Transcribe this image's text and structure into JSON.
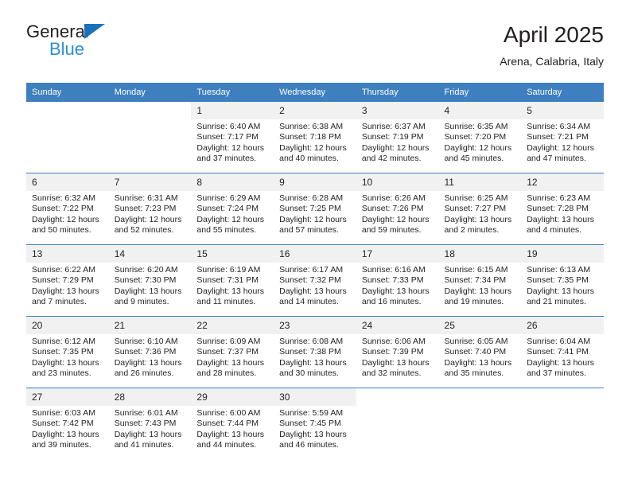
{
  "brand": {
    "line1": "General",
    "line2": "Blue",
    "triangle_color": "#1a72ba",
    "blue_text_color": "#2b8fd4"
  },
  "header": {
    "title": "April 2025",
    "subtitle": "Arena, Calabria, Italy"
  },
  "theme": {
    "header_blue": "#3d7fbf",
    "daynum_gray": "#f1f1f1",
    "text": "#231f20"
  },
  "weekday_headers": [
    "Sunday",
    "Monday",
    "Tuesday",
    "Wednesday",
    "Thursday",
    "Friday",
    "Saturday"
  ],
  "weeks": [
    [
      {
        "day": "",
        "sunrise": "",
        "sunset": "",
        "daylight": ""
      },
      {
        "day": "",
        "sunrise": "",
        "sunset": "",
        "daylight": ""
      },
      {
        "day": "1",
        "sunrise": "Sunrise: 6:40 AM",
        "sunset": "Sunset: 7:17 PM",
        "daylight": "Daylight: 12 hours and 37 minutes."
      },
      {
        "day": "2",
        "sunrise": "Sunrise: 6:38 AM",
        "sunset": "Sunset: 7:18 PM",
        "daylight": "Daylight: 12 hours and 40 minutes."
      },
      {
        "day": "3",
        "sunrise": "Sunrise: 6:37 AM",
        "sunset": "Sunset: 7:19 PM",
        "daylight": "Daylight: 12 hours and 42 minutes."
      },
      {
        "day": "4",
        "sunrise": "Sunrise: 6:35 AM",
        "sunset": "Sunset: 7:20 PM",
        "daylight": "Daylight: 12 hours and 45 minutes."
      },
      {
        "day": "5",
        "sunrise": "Sunrise: 6:34 AM",
        "sunset": "Sunset: 7:21 PM",
        "daylight": "Daylight: 12 hours and 47 minutes."
      }
    ],
    [
      {
        "day": "6",
        "sunrise": "Sunrise: 6:32 AM",
        "sunset": "Sunset: 7:22 PM",
        "daylight": "Daylight: 12 hours and 50 minutes."
      },
      {
        "day": "7",
        "sunrise": "Sunrise: 6:31 AM",
        "sunset": "Sunset: 7:23 PM",
        "daylight": "Daylight: 12 hours and 52 minutes."
      },
      {
        "day": "8",
        "sunrise": "Sunrise: 6:29 AM",
        "sunset": "Sunset: 7:24 PM",
        "daylight": "Daylight: 12 hours and 55 minutes."
      },
      {
        "day": "9",
        "sunrise": "Sunrise: 6:28 AM",
        "sunset": "Sunset: 7:25 PM",
        "daylight": "Daylight: 12 hours and 57 minutes."
      },
      {
        "day": "10",
        "sunrise": "Sunrise: 6:26 AM",
        "sunset": "Sunset: 7:26 PM",
        "daylight": "Daylight: 12 hours and 59 minutes."
      },
      {
        "day": "11",
        "sunrise": "Sunrise: 6:25 AM",
        "sunset": "Sunset: 7:27 PM",
        "daylight": "Daylight: 13 hours and 2 minutes."
      },
      {
        "day": "12",
        "sunrise": "Sunrise: 6:23 AM",
        "sunset": "Sunset: 7:28 PM",
        "daylight": "Daylight: 13 hours and 4 minutes."
      }
    ],
    [
      {
        "day": "13",
        "sunrise": "Sunrise: 6:22 AM",
        "sunset": "Sunset: 7:29 PM",
        "daylight": "Daylight: 13 hours and 7 minutes."
      },
      {
        "day": "14",
        "sunrise": "Sunrise: 6:20 AM",
        "sunset": "Sunset: 7:30 PM",
        "daylight": "Daylight: 13 hours and 9 minutes."
      },
      {
        "day": "15",
        "sunrise": "Sunrise: 6:19 AM",
        "sunset": "Sunset: 7:31 PM",
        "daylight": "Daylight: 13 hours and 11 minutes."
      },
      {
        "day": "16",
        "sunrise": "Sunrise: 6:17 AM",
        "sunset": "Sunset: 7:32 PM",
        "daylight": "Daylight: 13 hours and 14 minutes."
      },
      {
        "day": "17",
        "sunrise": "Sunrise: 6:16 AM",
        "sunset": "Sunset: 7:33 PM",
        "daylight": "Daylight: 13 hours and 16 minutes."
      },
      {
        "day": "18",
        "sunrise": "Sunrise: 6:15 AM",
        "sunset": "Sunset: 7:34 PM",
        "daylight": "Daylight: 13 hours and 19 minutes."
      },
      {
        "day": "19",
        "sunrise": "Sunrise: 6:13 AM",
        "sunset": "Sunset: 7:35 PM",
        "daylight": "Daylight: 13 hours and 21 minutes."
      }
    ],
    [
      {
        "day": "20",
        "sunrise": "Sunrise: 6:12 AM",
        "sunset": "Sunset: 7:35 PM",
        "daylight": "Daylight: 13 hours and 23 minutes."
      },
      {
        "day": "21",
        "sunrise": "Sunrise: 6:10 AM",
        "sunset": "Sunset: 7:36 PM",
        "daylight": "Daylight: 13 hours and 26 minutes."
      },
      {
        "day": "22",
        "sunrise": "Sunrise: 6:09 AM",
        "sunset": "Sunset: 7:37 PM",
        "daylight": "Daylight: 13 hours and 28 minutes."
      },
      {
        "day": "23",
        "sunrise": "Sunrise: 6:08 AM",
        "sunset": "Sunset: 7:38 PM",
        "daylight": "Daylight: 13 hours and 30 minutes."
      },
      {
        "day": "24",
        "sunrise": "Sunrise: 6:06 AM",
        "sunset": "Sunset: 7:39 PM",
        "daylight": "Daylight: 13 hours and 32 minutes."
      },
      {
        "day": "25",
        "sunrise": "Sunrise: 6:05 AM",
        "sunset": "Sunset: 7:40 PM",
        "daylight": "Daylight: 13 hours and 35 minutes."
      },
      {
        "day": "26",
        "sunrise": "Sunrise: 6:04 AM",
        "sunset": "Sunset: 7:41 PM",
        "daylight": "Daylight: 13 hours and 37 minutes."
      }
    ],
    [
      {
        "day": "27",
        "sunrise": "Sunrise: 6:03 AM",
        "sunset": "Sunset: 7:42 PM",
        "daylight": "Daylight: 13 hours and 39 minutes."
      },
      {
        "day": "28",
        "sunrise": "Sunrise: 6:01 AM",
        "sunset": "Sunset: 7:43 PM",
        "daylight": "Daylight: 13 hours and 41 minutes."
      },
      {
        "day": "29",
        "sunrise": "Sunrise: 6:00 AM",
        "sunset": "Sunset: 7:44 PM",
        "daylight": "Daylight: 13 hours and 44 minutes."
      },
      {
        "day": "30",
        "sunrise": "Sunrise: 5:59 AM",
        "sunset": "Sunset: 7:45 PM",
        "daylight": "Daylight: 13 hours and 46 minutes."
      },
      {
        "day": "",
        "sunrise": "",
        "sunset": "",
        "daylight": ""
      },
      {
        "day": "",
        "sunrise": "",
        "sunset": "",
        "daylight": ""
      },
      {
        "day": "",
        "sunrise": "",
        "sunset": "",
        "daylight": ""
      }
    ]
  ]
}
